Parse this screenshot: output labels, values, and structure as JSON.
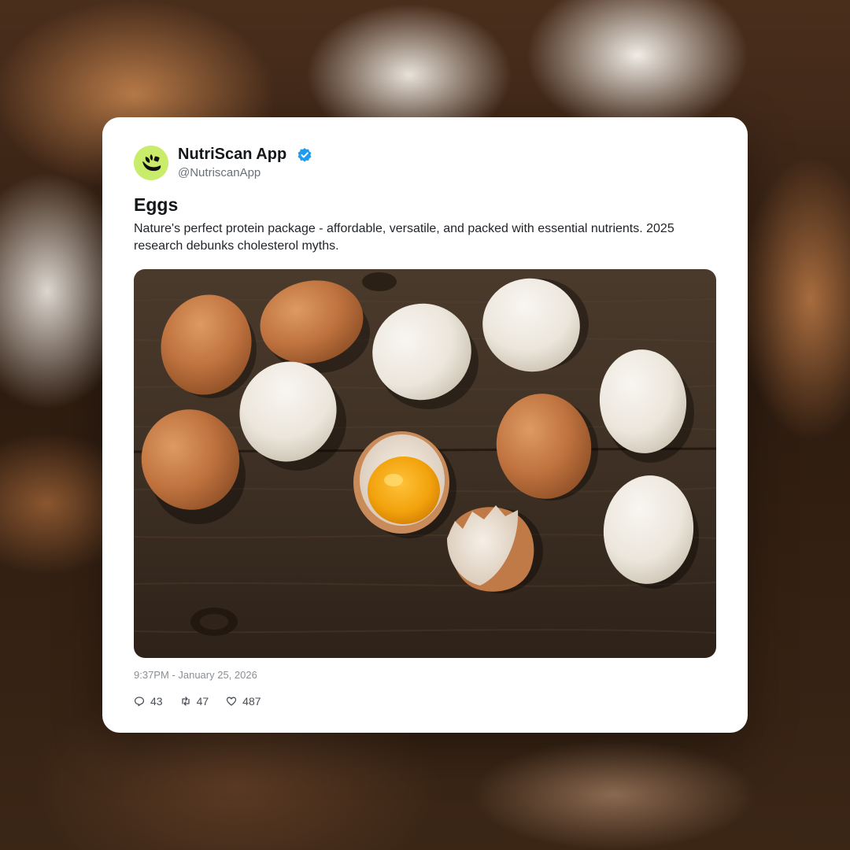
{
  "account": {
    "display_name": "NutriScan App",
    "handle": "@NutriscanApp",
    "verified": true,
    "avatar_icon": "plant-leaf-icon",
    "brand_color": "#c9ec6a"
  },
  "post": {
    "title": "Eggs",
    "body": "Nature's perfect protein package - affordable, versatile, and packed with essential nutrients. 2025 research debunks cholesterol myths.",
    "image_subject": "eggs-on-wooden-table",
    "timestamp": "9:37PM - January 25, 2026"
  },
  "stats": {
    "replies": "43",
    "retweets": "47",
    "likes": "487"
  },
  "colors": {
    "verified_badge": "#1d9bf0",
    "text_primary": "#14171a",
    "text_secondary": "#6b7078"
  }
}
